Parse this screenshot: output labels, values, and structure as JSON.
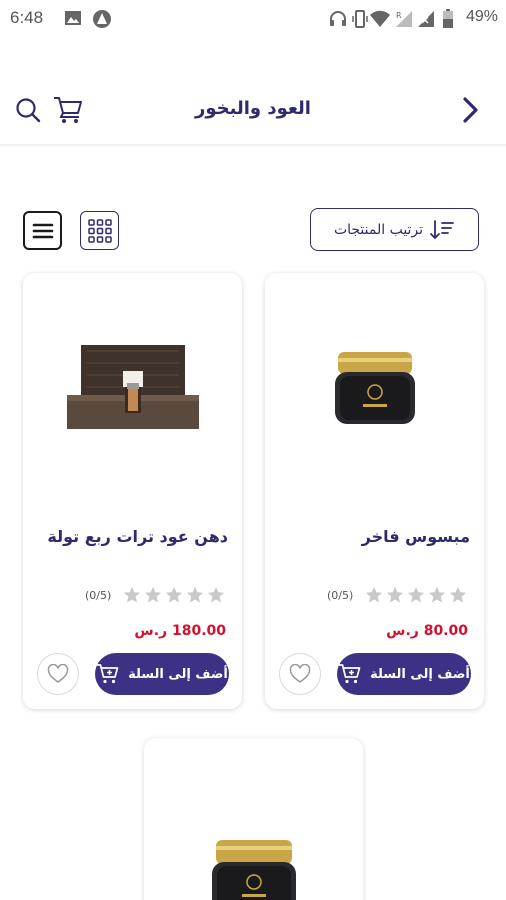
{
  "status_bar": {
    "time": "6:48",
    "battery": "49%",
    "icons": [
      "image-icon",
      "app-icon",
      "headphones-icon",
      "vibrate-icon",
      "wifi-icon",
      "signal-r-icon",
      "signal-icon",
      "battery-icon"
    ]
  },
  "header": {
    "title": "العود والبخور",
    "back_icon": "chevron-right-icon",
    "search_icon": "search-icon",
    "cart_icon": "cart-icon"
  },
  "toolbar": {
    "sort_label": "ترتيب المنتجات",
    "sort_icon": "sort-icon",
    "grid_icon": "grid-view-icon",
    "list_icon": "list-view-icon"
  },
  "products": [
    {
      "name": "مبسوس فاخر",
      "rating_count": "(0/5)",
      "price": "80.00 ر.س",
      "add_label": "أضف إلى السلة",
      "image": "black-jar-image"
    },
    {
      "name": "دهن عود ترات ربع تولة",
      "rating_count": "(0/5)",
      "price": "180.00 ر.س",
      "add_label": "أضف إلى السلة",
      "image": "wooden-box-image"
    },
    {
      "name": "",
      "image": "black-jar-image"
    }
  ],
  "colors": {
    "primary": "#3b3285",
    "title": "#2f2a6b",
    "price": "#d3102f",
    "star": "#c9c9c9"
  }
}
